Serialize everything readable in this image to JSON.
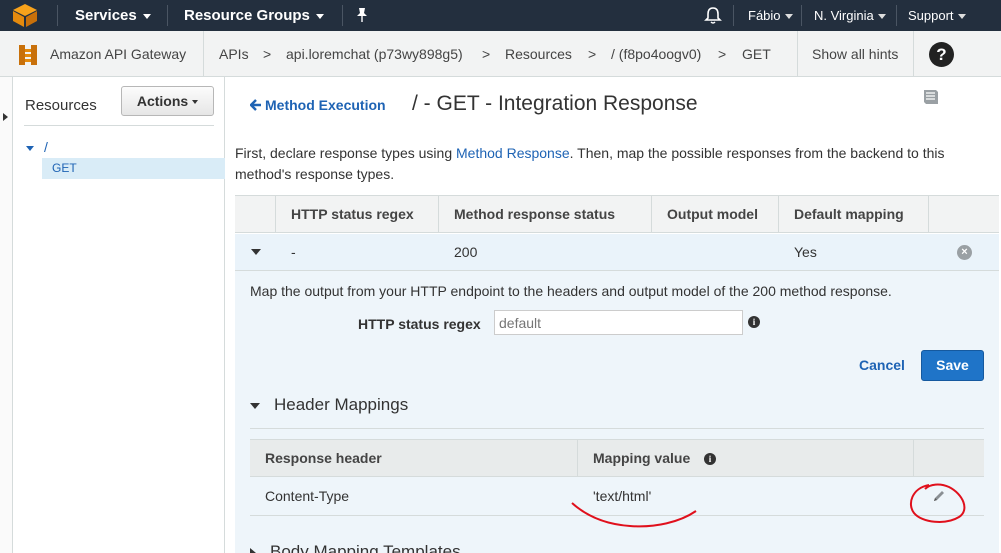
{
  "topnav": {
    "services": "Services",
    "resource_groups": "Resource Groups",
    "user": "Fábio",
    "region": "N. Virginia",
    "support": "Support",
    "icons": [
      "aws-cube-icon",
      "pin-icon",
      "bell-icon"
    ]
  },
  "breadcrumb": {
    "service": "Amazon API Gateway",
    "apis": "APIs",
    "sep": ">",
    "api_name": "api.loremchat (p73wy898g5)",
    "resources": "Resources",
    "resource_path": "/ (f8po4oogv0)",
    "method": "GET",
    "hints": "Show all hints",
    "help": "?"
  },
  "sidebar": {
    "title": "Resources",
    "actions_label": "Actions",
    "tree_root": "/",
    "tree_child": "GET"
  },
  "main": {
    "back_link": "Method Execution",
    "title": "/ - GET - Integration Response",
    "intro_before": "First, declare response types using ",
    "intro_link": "Method Response",
    "intro_after": ". Then, map the possible responses from the backend to this method's response types.",
    "table": {
      "headers": [
        "HTTP status regex",
        "Method response status",
        "Output model",
        "Default mapping"
      ],
      "row": {
        "regex": "-",
        "status": "200",
        "model": "",
        "default": "Yes"
      }
    },
    "detail": {
      "map_text": "Map the output from your HTTP endpoint to the headers and output model of the 200 method response.",
      "regex_label": "HTTP status regex",
      "regex_placeholder": "default",
      "cancel": "Cancel",
      "save": "Save",
      "header_mappings_title": "Header Mappings",
      "hm_headers": [
        "Response header",
        "Mapping value"
      ],
      "hm_row": {
        "header": "Content-Type",
        "value": "'text/html'"
      },
      "body_templates_title": "Body Mapping Templates"
    }
  },
  "colors": {
    "nav_bg": "#232f3e",
    "link": "#1e63b4",
    "primary_button": "#1f74c8",
    "annotation_red": "#e0101c"
  }
}
